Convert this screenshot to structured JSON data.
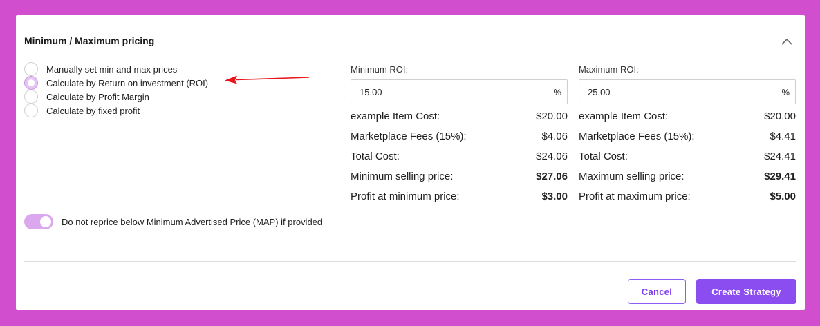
{
  "section": {
    "title": "Minimum / Maximum pricing"
  },
  "pricing_methods": [
    {
      "label": "Manually set min and max prices",
      "selected": false
    },
    {
      "label": "Calculate by Return on investment (ROI)",
      "selected": true
    },
    {
      "label": "Calculate by Profit Margin",
      "selected": false
    },
    {
      "label": "Calculate by fixed profit",
      "selected": false
    }
  ],
  "min_roi": {
    "label": "Minimum ROI:",
    "value": "15.00",
    "unit": "%",
    "rows": [
      {
        "label": "example Item Cost:",
        "value": "$20.00"
      },
      {
        "label": "Marketplace Fees (15%):",
        "value": "$4.06"
      },
      {
        "label": "Total Cost:",
        "value": "$24.06"
      },
      {
        "label": "Minimum selling price:",
        "value": "$27.06"
      },
      {
        "label": "Profit at minimum price:",
        "value": "$3.00"
      }
    ]
  },
  "max_roi": {
    "label": "Maximum ROI:",
    "value": "25.00",
    "unit": "%",
    "rows": [
      {
        "label": "example Item Cost:",
        "value": "$20.00"
      },
      {
        "label": "Marketplace Fees (15%):",
        "value": "$4.41"
      },
      {
        "label": "Total Cost:",
        "value": "$24.41"
      },
      {
        "label": "Maximum selling price:",
        "value": "$29.41"
      },
      {
        "label": "Profit at maximum price:",
        "value": "$5.00"
      }
    ]
  },
  "map_toggle": {
    "label": "Do not reprice below Minimum Advertised Price (MAP) if provided",
    "enabled": true
  },
  "actions": {
    "cancel_label": "Cancel",
    "create_label": "Create Strategy"
  },
  "icons": {
    "collapse": "chevron-up-icon",
    "annotation": "red-arrow-icon"
  },
  "colors": {
    "background": "#d14fcf",
    "accent": "#8b4cf0",
    "radio_selected": "#e5c6f3",
    "toggle_on": "#dba8ef",
    "annotation_arrow": "#e8161b"
  }
}
